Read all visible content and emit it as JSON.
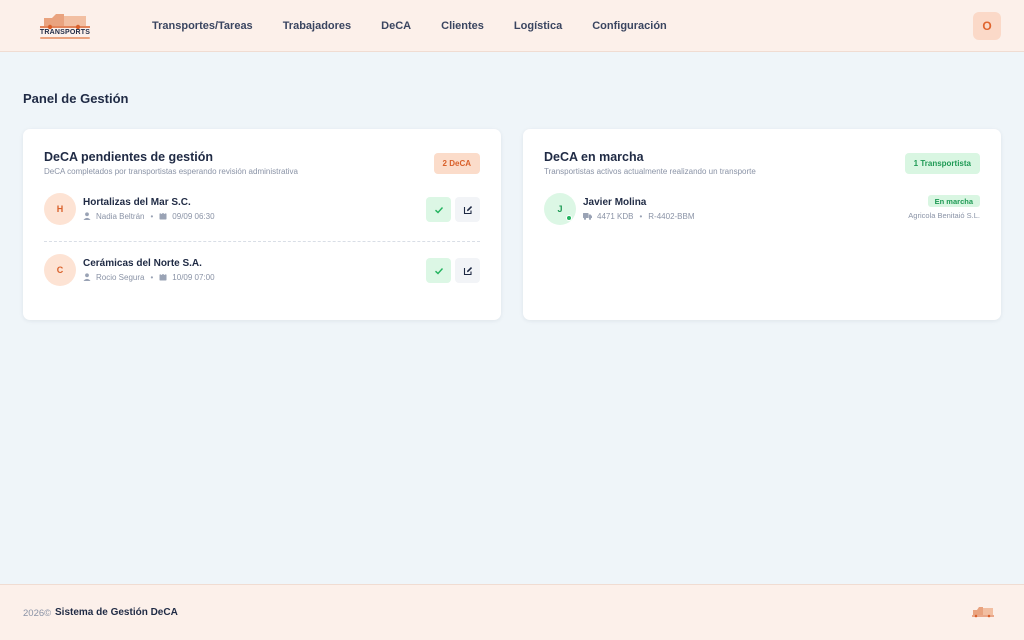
{
  "header": {
    "logo_text": "TRANSPORTS",
    "nav": [
      {
        "label": "Transportes/Tareas"
      },
      {
        "label": "Trabajadores"
      },
      {
        "label": "DeCA"
      },
      {
        "label": "Clientes"
      },
      {
        "label": "Logística"
      },
      {
        "label": "Configuración"
      }
    ],
    "user_initial": "O"
  },
  "page": {
    "title": "Panel de Gestión"
  },
  "pending": {
    "title": "DeCA pendientes de gestión",
    "subtitle": "DeCA completados por transportistas esperando revisión administrativa",
    "badge": "2 DeCA",
    "items": [
      {
        "initial": "H",
        "name": "Hortalizas del Mar S.C.",
        "person": "Nadia Beltrán",
        "datetime": "09/09 06:30"
      },
      {
        "initial": "C",
        "name": "Cerámicas del Norte S.A.",
        "person": "Rocio Segura",
        "datetime": "10/09 07:00"
      }
    ]
  },
  "running": {
    "title": "DeCA en marcha",
    "subtitle": "Transportistas activos actualmente realizando un transporte",
    "badge": "1 Transportista",
    "items": [
      {
        "initial": "J",
        "name": "Javier Molina",
        "vehicle": "4471 KDB",
        "trailer": "R-4402-BBM",
        "status": "En marcha",
        "company": "Agricola Benitaió S.L."
      }
    ]
  },
  "footer": {
    "year": "2026©",
    "brand": "Sistema de Gestión DeCA"
  },
  "colors": {
    "accent": "#e0642e",
    "header_bg": "#fcf0ea",
    "success": "#1f9a55",
    "page_bg": "#eff5f9"
  }
}
